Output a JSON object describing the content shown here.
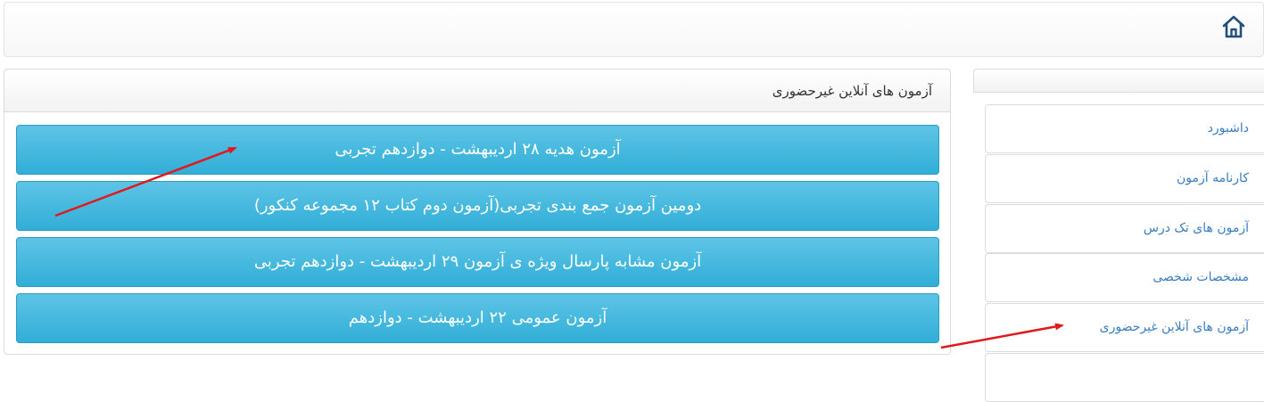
{
  "header": {
    "home_icon": "home-icon"
  },
  "panel": {
    "title": "آزمون های آنلاین غیرحضوری",
    "exams": [
      "آزمون هدیه ۲۸ اردیبهشت - دوازدهم تجربی",
      "دومین آزمون جمع بندی تجربی(آزمون دوم کتاب ۱۲ مجموعه کنکور)",
      "آزمون مشابه پارسال ویژه ی آزمون ۲۹ اردیبهشت - دوازدهم تجربی",
      "آزمون عمومی ۲۲ اردیبهشت - دوازدهم"
    ]
  },
  "sidebar": {
    "items": [
      "داشبورد",
      "کارنامه آزمون",
      "آزمون های تک درس",
      "مشخصات شخصی",
      "آزمون های آنلاین غیرحضوری"
    ]
  },
  "colors": {
    "button_top": "#5ec4e6",
    "button_bottom": "#31aed7",
    "link": "#3a7ec0",
    "arrow": "#e0191c"
  }
}
